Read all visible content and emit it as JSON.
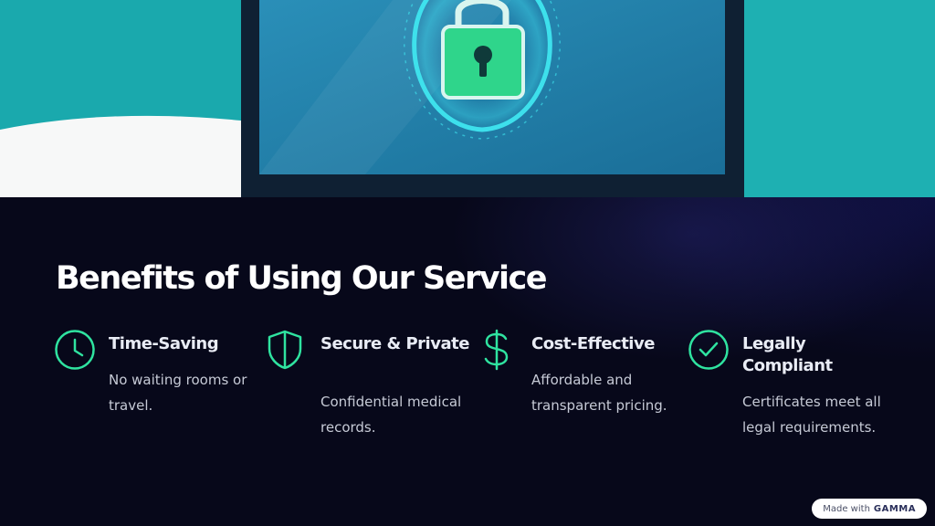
{
  "hero": {
    "alt": "Laptop screen with padlock icon",
    "colors": {
      "teal": "#1aa9ad",
      "screen": "#1e7fa8",
      "lock_green": "#2fd58b",
      "glow": "#3fe6f0"
    }
  },
  "main": {
    "title": "Benefits of Using Our Service",
    "benefits": [
      {
        "icon": "clock-icon",
        "title": "Time-Saving",
        "description": "No waiting rooms or travel."
      },
      {
        "icon": "shield-icon",
        "title": "Secure & Private",
        "description": "Confidential medical records."
      },
      {
        "icon": "dollar-icon",
        "title": "Cost-Effective",
        "description": "Affordable and transparent pricing."
      },
      {
        "icon": "check-circle-icon",
        "title": "Legally Compliant",
        "description": "Certificates meet all legal requirements."
      }
    ],
    "accent_color": "#2fe3a0"
  },
  "badge": {
    "made_with": "Made with",
    "brand": "GAMMA"
  }
}
